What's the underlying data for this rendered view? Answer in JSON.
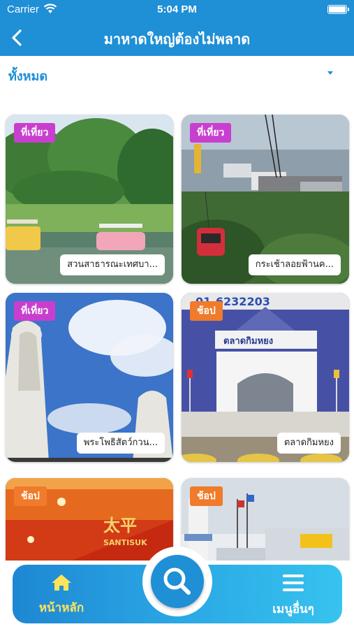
{
  "status_bar": {
    "carrier": "Carrier",
    "time": "5:04 PM"
  },
  "nav": {
    "title": "มาหาดใหญ่ต้องไม่พลาด"
  },
  "filter": {
    "selected": "ทั้งหมด"
  },
  "cards": [
    {
      "tag": "ที่เที่ยว",
      "title": "สวนสาธารณะเทศบา..."
    },
    {
      "tag": "ที่เที่ยว",
      "title": "กระเช้าลอยฟ้านค..."
    },
    {
      "tag": "ที่เที่ยว",
      "title": "พระโพธิสัตว์กวน..."
    },
    {
      "tag": "ช้อป",
      "title": "ตลาดกิมหยง"
    },
    {
      "tag": "ช้อป",
      "title": ""
    },
    {
      "tag": "ช้อป",
      "title": ""
    }
  ],
  "card_photo_text": {
    "sign_number": "01-6232203",
    "market_sign": "ตลาดกิมหยง",
    "shop_sign": "SANTISUK"
  },
  "tabbar": {
    "home_label": "หน้าหลัก",
    "menu_label": "เมนูอื่นๆ"
  },
  "colors": {
    "primary": "#1f8fd6",
    "tag_place": "#c83fcf",
    "tag_shop": "#f07b2a",
    "home_active": "#ffe45a"
  },
  "icons": [
    "wifi-icon",
    "battery-icon",
    "back-arrow-icon",
    "dropdown-caret-icon",
    "home-icon",
    "search-icon",
    "hamburger-menu-icon"
  ]
}
